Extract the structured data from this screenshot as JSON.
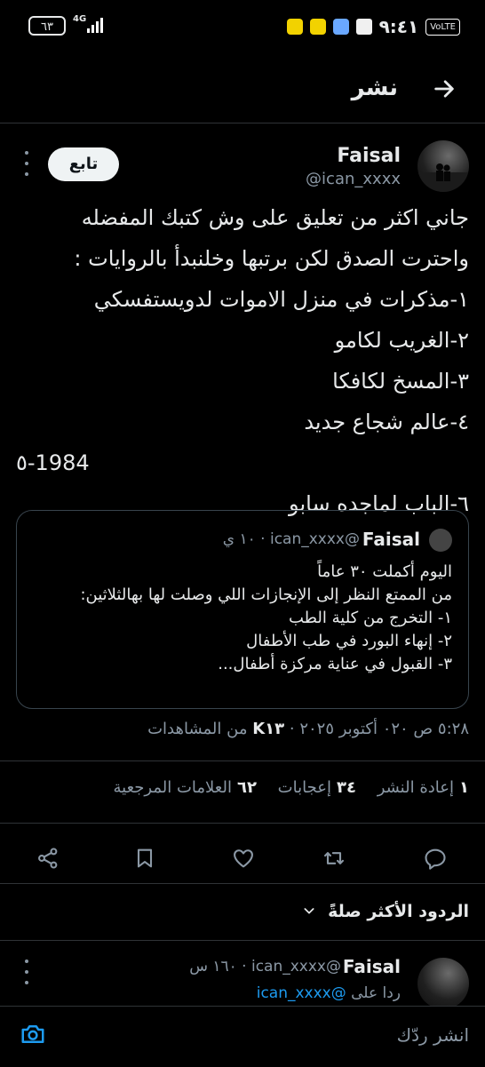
{
  "status_bar": {
    "time": "٩:٤١",
    "battery": "٦٣",
    "network": "4G",
    "volte": "VoLTE"
  },
  "header": {
    "title": "نشر",
    "back_icon": "arrow-right-icon"
  },
  "post": {
    "author_name": "Faisal",
    "author_handle": "@ican_xxxx",
    "follow_label": "تابع",
    "text_lines": [
      "جاني اكثر من تعليق على وش كتبك المفضله",
      "واحترت الصدق لكن برتبها وخلنبدأ بالروايات :",
      "١-مذكرات في منزل الاموات لدويستفسكي",
      "٢-الغريب لكامو",
      "٣-المسخ لكافكا",
      "٤-عالم شجاع جديد",
      "٥-1984",
      "٦-الباب لماجده سابو"
    ]
  },
  "quote": {
    "author_name": "Faisal",
    "author_handle": "@ican_xxxx · ١٠ ي",
    "text_lines": [
      "اليوم أكملت ٣٠ عاماً",
      "من الممتع النظر إلى الإنجازات اللي وصلت لها بهالثلاثين:",
      "١- التخرج من كلية الطب",
      "٢- إنهاء البورد في طب الأطفال",
      "٣- القبول في عناية مركزة أطفال..."
    ]
  },
  "meta": {
    "time_date": "٥:٢٨ ص ٠٢٠ أكتوبر ٢٠٢٥ ·",
    "views_count": "K١٣",
    "views_label": "من المشاهدات"
  },
  "stats": {
    "reposts_count": "١",
    "reposts_label": "إعادة النشر",
    "likes_count": "٣٤",
    "likes_label": "إعجابات",
    "bookmarks_count": "٦٢",
    "bookmarks_label": "العلامات المرجعية"
  },
  "actions": {
    "reply_icon": "reply-icon",
    "repost_icon": "repost-icon",
    "like_icon": "heart-icon",
    "bookmark_icon": "bookmark-icon",
    "share_icon": "share-icon"
  },
  "relevant": {
    "label": "الردود الأكثر صلةً"
  },
  "reply": {
    "author_name": "Faisal",
    "author_handle": "@ican_xxxx · ١٦٠ س",
    "replying_prefix": "ردا على",
    "replying_handle": "@ican_xxxx"
  },
  "composer": {
    "placeholder": "انشر ردّك",
    "camera_icon": "camera-icon"
  },
  "colors": {
    "background": "#000000",
    "text": "#e7e9ea",
    "secondary": "#8b98a5",
    "accent": "#1d9bf0",
    "border": "#2f3336"
  }
}
